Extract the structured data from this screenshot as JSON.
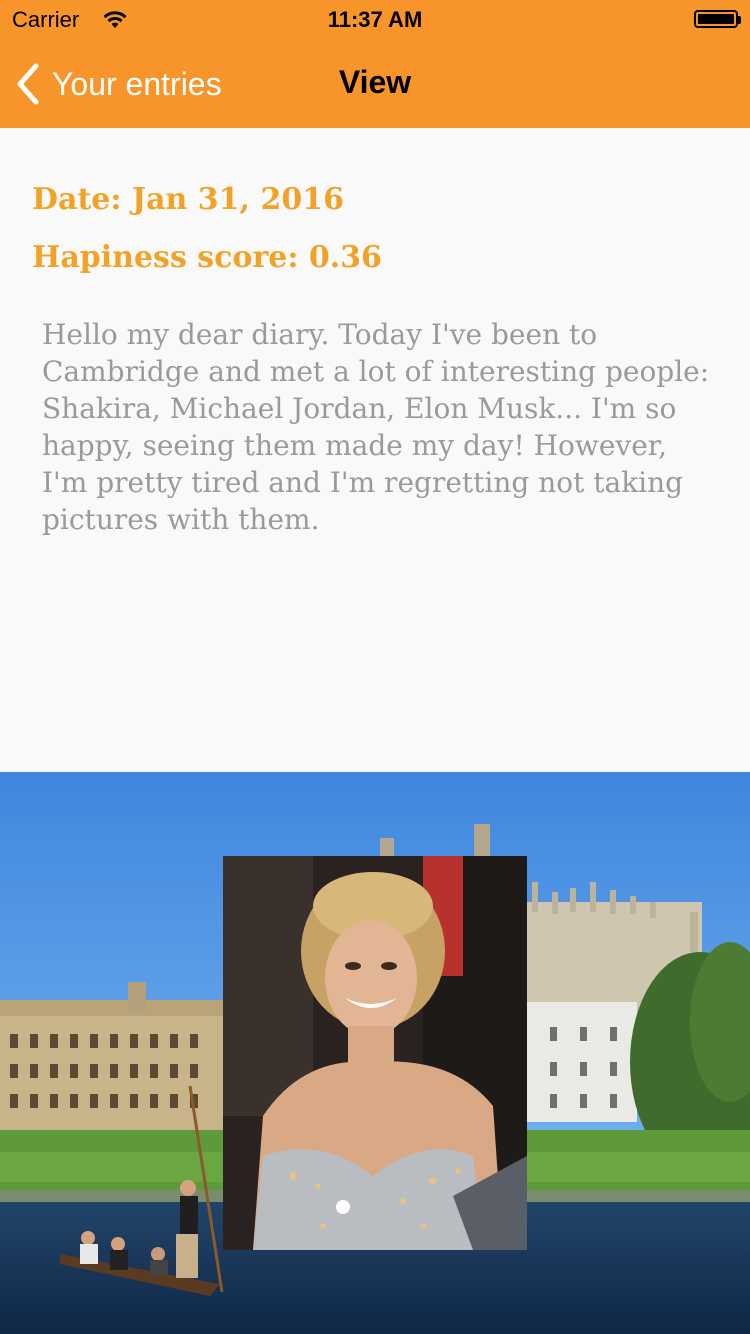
{
  "status_bar": {
    "carrier": "Carrier",
    "time": "11:37 AM"
  },
  "nav": {
    "back_label": "Your entries",
    "title": "View"
  },
  "entry": {
    "date": "Date: Jan 31, 2016",
    "happiness": "Hapiness score: 0.36",
    "text": "Hello my dear diary. Today I've been to Cambridge and met a lot of interesting people: Shakira, Michael Jordan, Elon Musk... I'm so happy, seeing them made my day! However, I'm pretty tired and I'm regretting not taking pictures with them."
  },
  "colors": {
    "nav_background": "#f7952a",
    "accent": "#f2a227",
    "body_text": "#9a9a9a",
    "background": "#f9f9f9"
  },
  "icons": {
    "back": "chevron-left-icon",
    "wifi": "wifi-icon",
    "battery": "battery-icon"
  }
}
